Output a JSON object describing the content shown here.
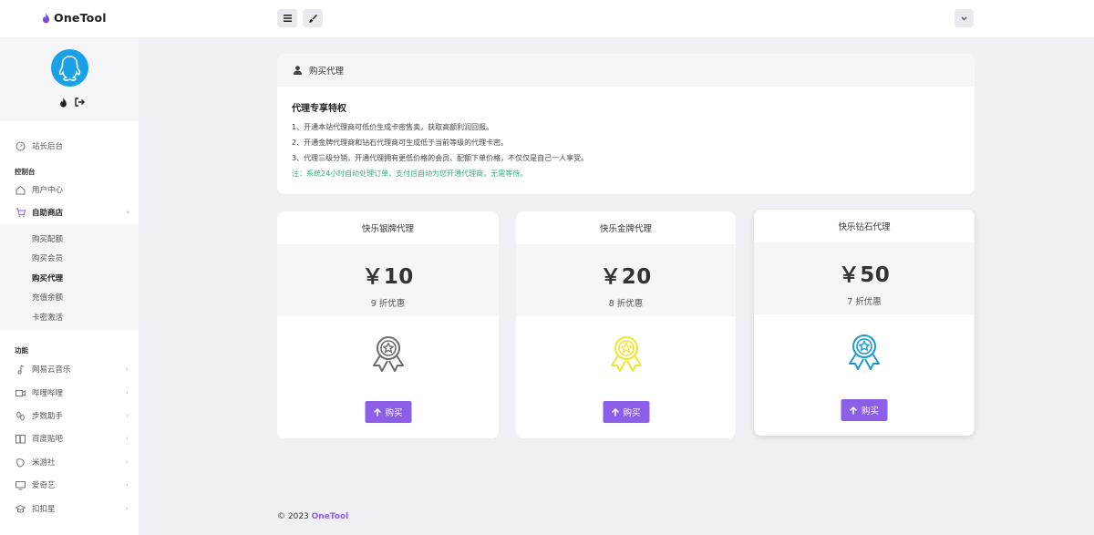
{
  "app": {
    "name": "OneTool"
  },
  "colors": {
    "accent": "#8d5ee8",
    "note": "#2bb673",
    "silver": "#6b6b6b",
    "gold": "#f1e62e",
    "diamond": "#1a9ad6"
  },
  "topbar": {
    "menu_icon": "hamburger-icon",
    "theme_icon": "brush-icon",
    "dropdown_icon": "chevron-down-icon"
  },
  "sidebar": {
    "dashboard": "站长后台",
    "section_console": "控制台",
    "user_center": "用户中心",
    "shop": "自助商店",
    "shop_sub": [
      "购买配额",
      "购买会员",
      "购买代理",
      "充值余额",
      "卡密激活"
    ],
    "section_features": "功能",
    "features": [
      "网易云音乐",
      "哔哩哔哩",
      "步数助手",
      "百度贴吧",
      "米游社",
      "爱奇艺",
      "扣扣星"
    ]
  },
  "intro": {
    "header": "购买代理",
    "heading": "代理专享特权",
    "lines": [
      "1、开通本站代理商可低价生成卡密售卖，获取高额利润回报。",
      "2、开通金牌代理商和钻石代理商可生成低于当前等级的代理卡密。",
      "3、代理三级分销，开通代理拥有更低价格的会员、配额下单价格，不仅仅是自己一人享受。"
    ],
    "note": "注：系统24小时自动处理订单，支付后自动为您开通代理商，无需等待。"
  },
  "plans": [
    {
      "title": "快乐银牌代理",
      "price": "￥10",
      "discount": "9 折优惠",
      "buy_label": "购买"
    },
    {
      "title": "快乐金牌代理",
      "price": "￥20",
      "discount": "8 折优惠",
      "buy_label": "购买"
    },
    {
      "title": "快乐钻石代理",
      "price": "￥50",
      "discount": "7 折优惠",
      "buy_label": "购买"
    }
  ],
  "footer": {
    "copyright": "© 2023",
    "brand": "OneTool"
  }
}
